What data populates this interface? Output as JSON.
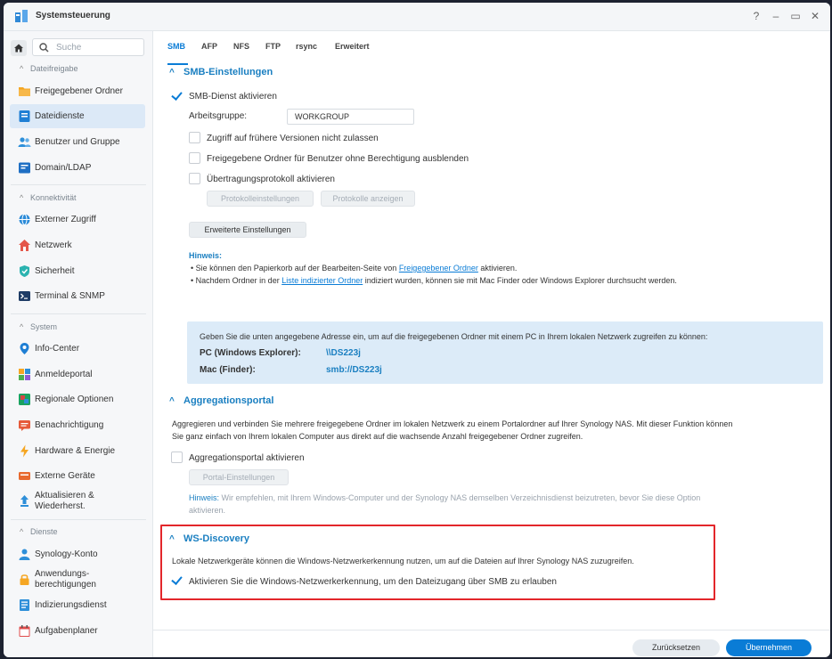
{
  "window": {
    "title": "Systemsteuerung"
  },
  "controls": {
    "help": "?",
    "minimize": "–",
    "maximize": "▭",
    "close": "✕"
  },
  "search": {
    "placeholder": "Suche"
  },
  "sidebar": {
    "sections": [
      {
        "label": "Dateifreigabe"
      },
      {
        "label": "Konnektivität"
      },
      {
        "label": "System"
      },
      {
        "label": "Dienste"
      }
    ],
    "items": [
      {
        "label": "Freigegebener Ordner",
        "icon": "folder-icon"
      },
      {
        "label": "Dateidienste",
        "icon": "file-services-icon",
        "active": true
      },
      {
        "label": "Benutzer und Gruppe",
        "icon": "users-icon"
      },
      {
        "label": "Domain/LDAP",
        "icon": "domain-icon"
      },
      {
        "label": "Externer Zugriff",
        "icon": "globe-icon"
      },
      {
        "label": "Netzwerk",
        "icon": "network-icon"
      },
      {
        "label": "Sicherheit",
        "icon": "shield-icon"
      },
      {
        "label": "Terminal & SNMP",
        "icon": "terminal-icon"
      },
      {
        "label": "Info-Center",
        "icon": "info-icon"
      },
      {
        "label": "Anmeldeportal",
        "icon": "portal-icon"
      },
      {
        "label": "Regionale Optionen",
        "icon": "regional-icon"
      },
      {
        "label": "Benachrichtigung",
        "icon": "notification-icon"
      },
      {
        "label": "Hardware & Energie",
        "icon": "hardware-icon"
      },
      {
        "label": "Externe Geräte",
        "icon": "external-devices-icon"
      },
      {
        "label": "Aktualisieren &",
        "label2": "Wiederherst.",
        "icon": "update-icon"
      },
      {
        "label": "Synology-Konto",
        "icon": "account-icon"
      },
      {
        "label": "Anwendungs-",
        "label2": "berechtigungen",
        "icon": "lock-icon"
      },
      {
        "label": "Indizierungsdienst",
        "icon": "index-icon"
      },
      {
        "label": "Aufgabenplaner",
        "icon": "calendar-icon"
      }
    ]
  },
  "tabs": [
    "SMB",
    "AFP",
    "NFS",
    "FTP",
    "rsync",
    "Erweitert"
  ],
  "smb": {
    "title": "SMB-Einstellungen",
    "enable_label": "SMB-Dienst aktivieren",
    "workgroup_label": "Arbeitsgruppe:",
    "workgroup_value": "WORKGROUP",
    "opt_prev_versions": "Zugriff auf frühere Versionen nicht zulassen",
    "opt_hide_folders": "Freigegebene Ordner für Benutzer ohne Berechtigung ausblenden",
    "opt_transfer_log": "Übertragungsprotokoll aktivieren",
    "btn_log_settings": "Protokolleinstellungen",
    "btn_show_logs": "Protokolle anzeigen",
    "btn_advanced": "Erweiterte Einstellungen",
    "hint_title": "Hinweis:",
    "hint1_pre": "• Sie können den Papierkorb auf der Bearbeiten-Seite von ",
    "hint1_link": "Freigegebener Ordner",
    "hint1_post": " aktivieren.",
    "hint2_pre": "• Nachdem Ordner in der ",
    "hint2_link": "Liste indizierter Ordner",
    "hint2_post": " indiziert wurden, können sie mit Mac Finder oder Windows Explorer durchsucht werden.",
    "info_text": "Geben Sie die unten angegebene Adresse ein, um auf die freigegebenen Ordner mit einem PC in Ihrem lokalen Netzwerk zugreifen zu können:",
    "pc_label": "PC (Windows Explorer):",
    "pc_value": "\\\\DS223j",
    "mac_label": "Mac (Finder):",
    "mac_value": "smb://DS223j"
  },
  "aggregation": {
    "title": "Aggregationsportal",
    "desc1": "Aggregieren und verbinden Sie mehrere freigegebene Ordner im lokalen Netzwerk zu einem Portalordner auf Ihrer Synology NAS. Mit dieser Funktion können",
    "desc2": "Sie ganz einfach von Ihrem lokalen Computer aus direkt auf die wachsende Anzahl freigegebener Ordner zugreifen.",
    "enable_label": "Aggregationsportal aktivieren",
    "btn_portal": "Portal-Einstellungen",
    "hint_label": "Hinweis:",
    "hint_text1": " Wir empfehlen, mit Ihrem Windows-Computer und der Synology NAS demselben Verzeichnisdienst beizutreten, bevor Sie diese Option",
    "hint_text2": "aktivieren."
  },
  "wsd": {
    "title": "WS-Discovery",
    "desc": "Lokale Netzwerkgeräte können die Windows-Netzwerkerkennung nutzen, um auf die Dateien auf Ihrer Synology NAS zuzugreifen.",
    "enable_label": "Aktivieren Sie die Windows-Netzwerkerkennung, um den Dateizugang über SMB zu erlauben"
  },
  "footer": {
    "reset": "Zurücksetzen",
    "apply": "Übernehmen"
  },
  "colors": {
    "accent": "#0a7cd6",
    "highlight": "#e3262b"
  }
}
